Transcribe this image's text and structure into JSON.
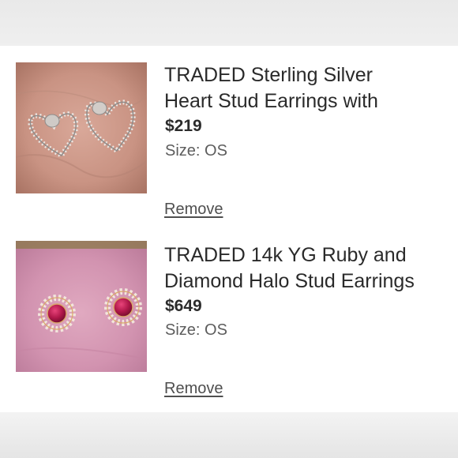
{
  "cart": {
    "items": [
      {
        "title_line1": "TRADED Sterling Silver",
        "title_line2": "Heart Stud Earrings with",
        "price": "$219",
        "size": "Size: OS",
        "remove_label": "Remove",
        "thumbnail": "heart-stud-earrings-photo"
      },
      {
        "title_line1": "TRADED 14k YG Ruby and",
        "title_line2": "Diamond Halo Stud Earrings",
        "price": "$649",
        "size": "Size: OS",
        "remove_label": "Remove",
        "thumbnail": "ruby-halo-earrings-photo"
      }
    ]
  },
  "colors": {
    "panel_background": "#ffffff",
    "page_background": "#ececec",
    "text_primary": "#2a2a2a",
    "text_secondary": "#5d5d5d",
    "ruby": "#b0184a",
    "gold": "#d9a86a"
  }
}
